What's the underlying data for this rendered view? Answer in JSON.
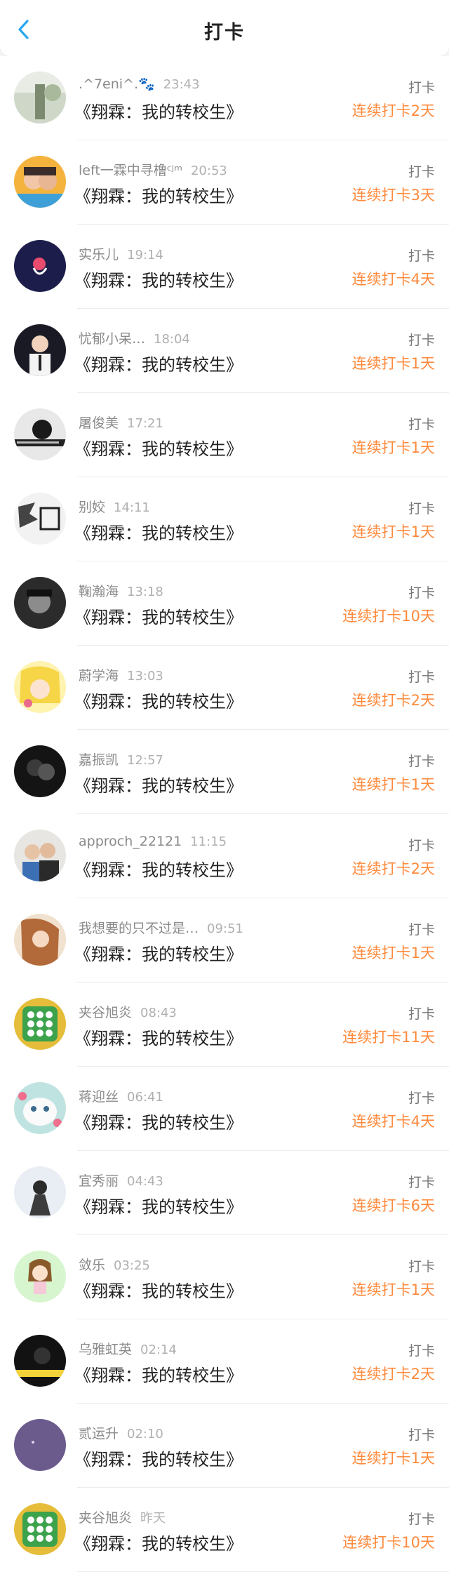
{
  "header": {
    "title": "打卡",
    "back_icon": "chevron-left-icon"
  },
  "colors": {
    "accent_blue": "#2aa7f0",
    "streak_orange": "#ff8a3d"
  },
  "items": [
    {
      "name": ".^7eni^.🐾",
      "time": "23:43",
      "book": "《翔霖：我的转校生》",
      "action": "打卡",
      "streak": "连续打卡2天"
    },
    {
      "name": "left一霖中寻橹ᶜʲᵐ",
      "time": "20:53",
      "book": "《翔霖：我的转校生》",
      "action": "打卡",
      "streak": "连续打卡3天"
    },
    {
      "name": "实乐儿",
      "time": "19:14",
      "book": "《翔霖：我的转校生》",
      "action": "打卡",
      "streak": "连续打卡4天"
    },
    {
      "name": "忧郁小呆…",
      "time": "18:04",
      "book": "《翔霖：我的转校生》",
      "action": "打卡",
      "streak": "连续打卡1天"
    },
    {
      "name": "屠俊美",
      "time": "17:21",
      "book": "《翔霖：我的转校生》",
      "action": "打卡",
      "streak": "连续打卡1天"
    },
    {
      "name": "别姣",
      "time": "14:11",
      "book": "《翔霖：我的转校生》",
      "action": "打卡",
      "streak": "连续打卡1天"
    },
    {
      "name": "鞠瀚海",
      "time": "13:18",
      "book": "《翔霖：我的转校生》",
      "action": "打卡",
      "streak": "连续打卡10天"
    },
    {
      "name": "蔚学海",
      "time": "13:03",
      "book": "《翔霖：我的转校生》",
      "action": "打卡",
      "streak": "连续打卡2天"
    },
    {
      "name": "嘉振凯",
      "time": "12:57",
      "book": "《翔霖：我的转校生》",
      "action": "打卡",
      "streak": "连续打卡1天"
    },
    {
      "name": "approch_22121",
      "time": "11:15",
      "book": "《翔霖：我的转校生》",
      "action": "打卡",
      "streak": "连续打卡2天"
    },
    {
      "name": "我想要的只不过是…",
      "time": "09:51",
      "book": "《翔霖：我的转校生》",
      "action": "打卡",
      "streak": "连续打卡1天"
    },
    {
      "name": "夹谷旭炎",
      "time": "08:43",
      "book": "《翔霖：我的转校生》",
      "action": "打卡",
      "streak": "连续打卡11天"
    },
    {
      "name": "蒋迎丝",
      "time": "06:41",
      "book": "《翔霖：我的转校生》",
      "action": "打卡",
      "streak": "连续打卡4天"
    },
    {
      "name": "宜秀丽",
      "time": "04:43",
      "book": "《翔霖：我的转校生》",
      "action": "打卡",
      "streak": "连续打卡6天"
    },
    {
      "name": "敛乐",
      "time": "03:25",
      "book": "《翔霖：我的转校生》",
      "action": "打卡",
      "streak": "连续打卡1天"
    },
    {
      "name": "乌雅虹英",
      "time": "02:14",
      "book": "《翔霖：我的转校生》",
      "action": "打卡",
      "streak": "连续打卡2天"
    },
    {
      "name": "贰运升",
      "time": "02:10",
      "book": "《翔霖：我的转校生》",
      "action": "打卡",
      "streak": "连续打卡1天"
    },
    {
      "name": "夹谷旭炎",
      "time": "昨天",
      "book": "《翔霖：我的转校生》",
      "action": "打卡",
      "streak": "连续打卡10天"
    }
  ]
}
